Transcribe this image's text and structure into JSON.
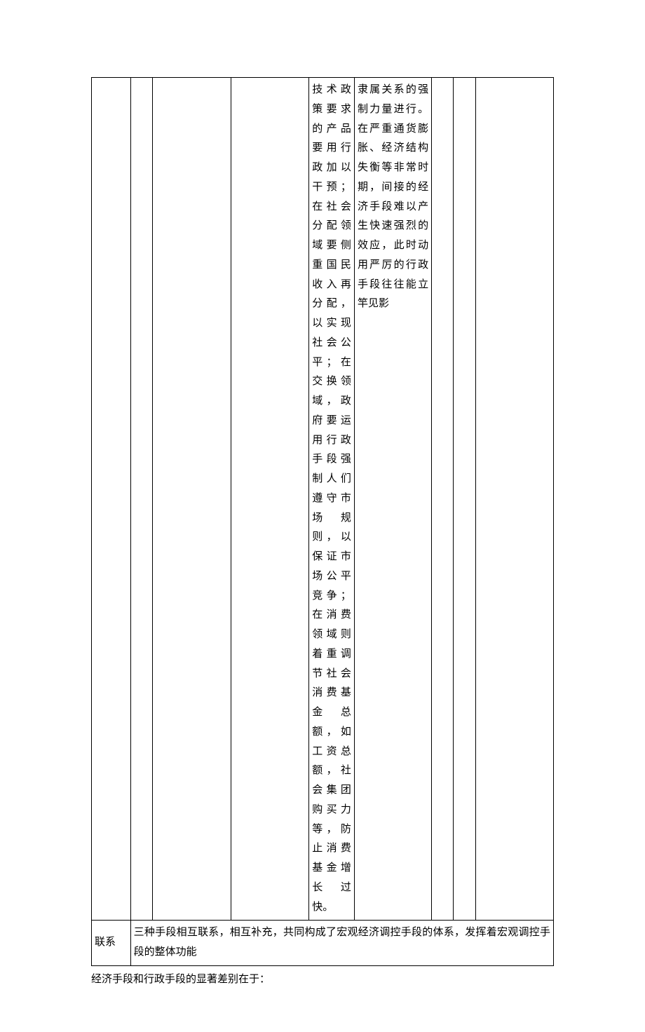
{
  "table": {
    "row1": {
      "c1": "",
      "c2": "",
      "c3": "",
      "c4": "技术政策要求的产品要用行政加以干预；在社会分配领域要侧重国民收入再分配，以实现社会公平；在交换领域，政府要运用行政手段强制人们遵守市场规则，以保证市场公平竞争；在消费领域则着重调节社会消费基金总额，如工资总额，社会集团购买力等，防止消费基金增长过快。",
      "c5": "隶属关系的强制力量进行。在严重通货膨胀、经济结构失衡等非常时期，间接的经济手段难以产生快速强烈的效应，此时动用严厉的行政手段往往能立竿见影",
      "c6": "",
      "c7": "",
      "c8": ""
    },
    "row2": {
      "label": "联系",
      "content": "三种手段相互联系，相互补充，共同构成了宏观经济调控手段的体系，发挥着宏观调控手段的整体功能"
    }
  },
  "footer": "经济手段和行政手段的显著差别在于："
}
